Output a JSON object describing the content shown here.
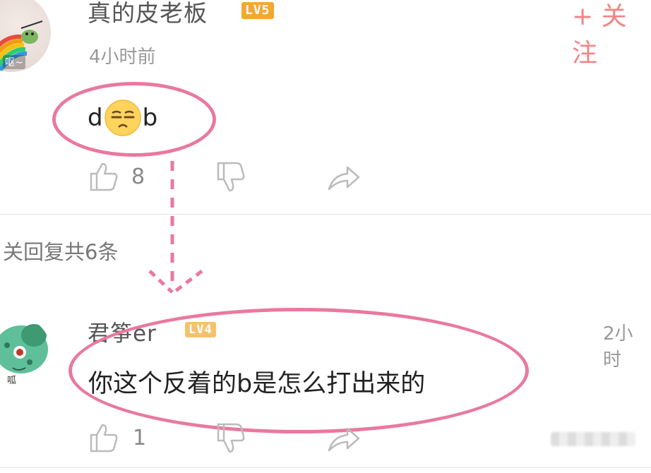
{
  "comment": {
    "username": "真的皮老板",
    "level": "LV5",
    "follow_label": "+ 关注",
    "time": "4小时前",
    "avatar_tag": "呕~",
    "text_before": "d",
    "text_after": "b",
    "emoji": "expressionless-face",
    "likes": "8"
  },
  "replies_label": "关回复共6条",
  "reply": {
    "username": "君筝er",
    "level": "LV4",
    "time": "2小时",
    "avatar_tag": "呱",
    "text": "你这个反着的b是怎么打出来的",
    "likes": "1"
  },
  "colors": {
    "highlight": "#e879a0",
    "follow": "#f08585",
    "level5": "#f2a830",
    "level4": "#f5c26b"
  }
}
